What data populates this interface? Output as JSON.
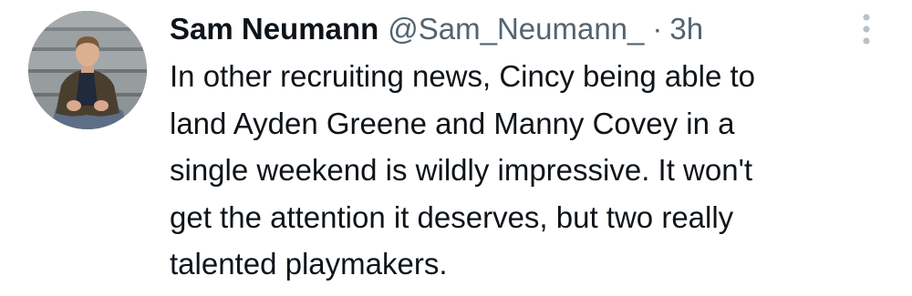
{
  "tweet": {
    "display_name": "Sam Neumann",
    "handle": "@Sam_Neumann_",
    "separator": "·",
    "timestamp": "3h",
    "text": "In other recruiting news, Cincy being able to\nland Ayden Greene and Manny Covey in a\nsingle weekend is wildly impressive. It won't\nget the attention it deserves, but two really\ntalented playmakers.",
    "avatar_icon": "profile-photo",
    "more_icon": "more-vertical-icon"
  },
  "colors": {
    "text_primary": "#0f1419",
    "text_secondary": "#536471",
    "background": "#ffffff"
  }
}
